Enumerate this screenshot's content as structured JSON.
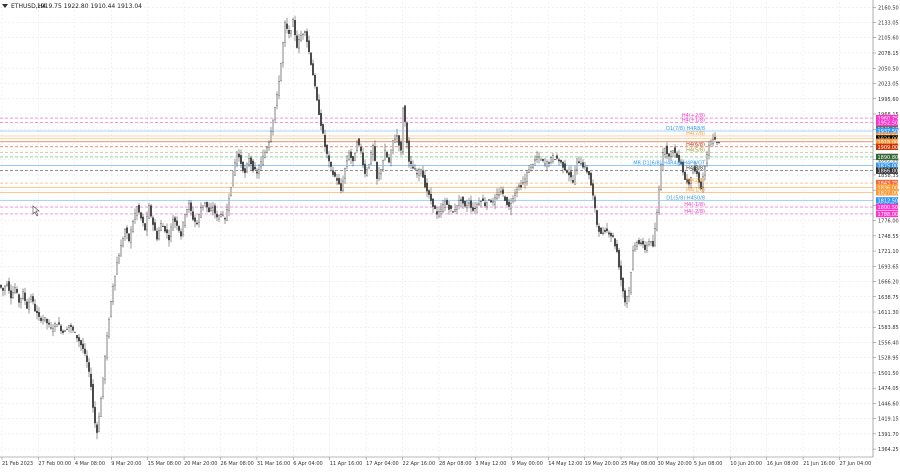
{
  "header": {
    "symbol": "ETHUSD,H4",
    "ohlc": "1919.75 1922.80 1910.44 1913.04"
  },
  "chart_data": {
    "type": "candlestick",
    "symbol": "ETHUSD",
    "timeframe": "H4",
    "grid": true,
    "ylim": [
      1350,
      2170
    ],
    "y_ticks": [
      "2160.50",
      "2133.05",
      "2105.60",
      "2078.15",
      "2050.50",
      "2023.05",
      "1995.60",
      "1968.15",
      "1940.70",
      "1913.25",
      "1885.80",
      "1858.35",
      "1830.90",
      "1803.45",
      "1776.00",
      "1748.55",
      "1721.10",
      "1693.65",
      "1666.20",
      "1638.75",
      "1611.30",
      "1583.85",
      "1556.40",
      "1528.95",
      "1501.50",
      "1474.05",
      "1446.60",
      "1419.15",
      "1391.70",
      "1364.25"
    ],
    "x_ticks": [
      "21 Feb 2023",
      "27 Feb 00:00",
      "4 Mar 08:00",
      "9 Mar 20:00",
      "15 Mar 08:00",
      "20 Mar 20:00",
      "26 Mar 08:00",
      "31 Mar 16:00",
      "6 Apr 04:00",
      "11 Apr 16:00",
      "17 Apr 04:00",
      "22 Apr 16:00",
      "28 Apr 08:00",
      "3 May 12:00",
      "9 May 00:00",
      "14 May 12:00",
      "19 May 20:00",
      "25 May 08:00",
      "30 May 20:00",
      "5 Jun 08:00",
      "10 Jun 20:00",
      "16 Jun 08:00",
      "21 Jun 16:00",
      "27 Jun 04:00"
    ],
    "price_path": [
      [
        0,
        1660
      ],
      [
        4,
        1650
      ],
      [
        8,
        1665
      ],
      [
        12,
        1640
      ],
      [
        16,
        1655
      ],
      [
        20,
        1630
      ],
      [
        24,
        1645
      ],
      [
        28,
        1620
      ],
      [
        32,
        1640
      ],
      [
        36,
        1615
      ],
      [
        40,
        1600
      ],
      [
        46,
        1598
      ],
      [
        52,
        1580
      ],
      [
        58,
        1592
      ],
      [
        64,
        1575
      ],
      [
        70,
        1588
      ],
      [
        76,
        1572
      ],
      [
        80,
        1560
      ],
      [
        84,
        1545
      ],
      [
        88,
        1520
      ],
      [
        92,
        1480
      ],
      [
        95,
        1420
      ],
      [
        98,
        1395
      ],
      [
        102,
        1455
      ],
      [
        106,
        1530
      ],
      [
        110,
        1600
      ],
      [
        114,
        1660
      ],
      [
        118,
        1700
      ],
      [
        122,
        1730
      ],
      [
        126,
        1760
      ],
      [
        130,
        1740
      ],
      [
        134,
        1775
      ],
      [
        138,
        1800
      ],
      [
        142,
        1780
      ],
      [
        146,
        1760
      ],
      [
        150,
        1800
      ],
      [
        154,
        1770
      ],
      [
        158,
        1745
      ],
      [
        162,
        1770
      ],
      [
        166,
        1760
      ],
      [
        170,
        1745
      ],
      [
        174,
        1780
      ],
      [
        178,
        1770
      ],
      [
        182,
        1750
      ],
      [
        186,
        1790
      ],
      [
        190,
        1805
      ],
      [
        194,
        1780
      ],
      [
        198,
        1770
      ],
      [
        202,
        1800
      ],
      [
        206,
        1810
      ],
      [
        210,
        1790
      ],
      [
        214,
        1800
      ],
      [
        218,
        1780
      ],
      [
        222,
        1790
      ],
      [
        226,
        1775
      ],
      [
        230,
        1820
      ],
      [
        234,
        1860
      ],
      [
        238,
        1900
      ],
      [
        242,
        1880
      ],
      [
        246,
        1860
      ],
      [
        250,
        1890
      ],
      [
        254,
        1870
      ],
      [
        258,
        1860
      ],
      [
        262,
        1880
      ],
      [
        266,
        1900
      ],
      [
        270,
        1920
      ],
      [
        274,
        1960
      ],
      [
        278,
        2000
      ],
      [
        282,
        2060
      ],
      [
        286,
        2130
      ],
      [
        290,
        2110
      ],
      [
        294,
        2135
      ],
      [
        298,
        2090
      ],
      [
        302,
        2110
      ],
      [
        306,
        2120
      ],
      [
        310,
        2080
      ],
      [
        314,
        2040
      ],
      [
        318,
        1990
      ],
      [
        322,
        1950
      ],
      [
        326,
        1910
      ],
      [
        330,
        1880
      ],
      [
        334,
        1860
      ],
      [
        338,
        1850
      ],
      [
        342,
        1830
      ],
      [
        346,
        1870
      ],
      [
        350,
        1900
      ],
      [
        354,
        1880
      ],
      [
        358,
        1920
      ],
      [
        362,
        1900
      ],
      [
        366,
        1860
      ],
      [
        370,
        1880
      ],
      [
        374,
        1910
      ],
      [
        378,
        1850
      ],
      [
        382,
        1870
      ],
      [
        386,
        1900
      ],
      [
        390,
        1880
      ],
      [
        394,
        1920
      ],
      [
        398,
        1930
      ],
      [
        402,
        1900
      ],
      [
        404,
        1980
      ],
      [
        407,
        1940
      ],
      [
        410,
        1880
      ],
      [
        414,
        1870
      ],
      [
        418,
        1860
      ],
      [
        422,
        1870
      ],
      [
        426,
        1840
      ],
      [
        430,
        1820
      ],
      [
        434,
        1805
      ],
      [
        438,
        1785
      ],
      [
        442,
        1795
      ],
      [
        446,
        1810
      ],
      [
        450,
        1800
      ],
      [
        454,
        1790
      ],
      [
        458,
        1805
      ],
      [
        462,
        1815
      ],
      [
        466,
        1800
      ],
      [
        470,
        1810
      ],
      [
        474,
        1795
      ],
      [
        478,
        1805
      ],
      [
        482,
        1815
      ],
      [
        486,
        1805
      ],
      [
        490,
        1815
      ],
      [
        494,
        1808
      ],
      [
        498,
        1820
      ],
      [
        502,
        1830
      ],
      [
        506,
        1815
      ],
      [
        510,
        1800
      ],
      [
        514,
        1820
      ],
      [
        518,
        1835
      ],
      [
        522,
        1840
      ],
      [
        526,
        1850
      ],
      [
        530,
        1870
      ],
      [
        534,
        1880
      ],
      [
        538,
        1890
      ],
      [
        542,
        1885
      ],
      [
        546,
        1878
      ],
      [
        550,
        1882
      ],
      [
        554,
        1890
      ],
      [
        558,
        1888
      ],
      [
        562,
        1880
      ],
      [
        566,
        1870
      ],
      [
        570,
        1860
      ],
      [
        574,
        1845
      ],
      [
        578,
        1885
      ],
      [
        582,
        1880
      ],
      [
        586,
        1870
      ],
      [
        590,
        1860
      ],
      [
        594,
        1820
      ],
      [
        598,
        1770
      ],
      [
        602,
        1750
      ],
      [
        606,
        1760
      ],
      [
        610,
        1755
      ],
      [
        614,
        1745
      ],
      [
        618,
        1720
      ],
      [
        622,
        1670
      ],
      [
        626,
        1630
      ],
      [
        630,
        1650
      ],
      [
        634,
        1720
      ],
      [
        638,
        1740
      ],
      [
        642,
        1735
      ],
      [
        646,
        1725
      ],
      [
        650,
        1740
      ],
      [
        654,
        1730
      ],
      [
        658,
        1790
      ],
      [
        662,
        1880
      ],
      [
        666,
        1910
      ],
      [
        670,
        1890
      ],
      [
        674,
        1905
      ],
      [
        678,
        1890
      ],
      [
        682,
        1880
      ],
      [
        686,
        1850
      ],
      [
        690,
        1845
      ],
      [
        694,
        1870
      ],
      [
        698,
        1860
      ],
      [
        702,
        1835
      ],
      [
        706,
        1875
      ],
      [
        710,
        1910
      ],
      [
        714,
        1925
      ],
      [
        718,
        1915
      ]
    ],
    "levels": [
      {
        "label": "H4(+2/8)",
        "value": 1960.75,
        "color": "#ff33cc",
        "dash": true
      },
      {
        "label": "H4(+1/8)",
        "value": 1952.5,
        "color": "#ff33cc",
        "dash": true
      },
      {
        "label": "D1(7/8) H4R8/8",
        "value": 1937.5,
        "color": "#3399ff",
        "dash": false
      },
      {
        "label": "H4(7/8)",
        "value": 1928.5,
        "color": "#ff9933",
        "dash": false
      },
      {
        "label": "",
        "value": 1924.0,
        "color": "#ff9933",
        "dash": false
      },
      {
        "label": "",
        "value": 1918.0,
        "color": "#cc3300",
        "dash": false
      },
      {
        "label": "H4(6/8)",
        "value": 1909.0,
        "color": "#cc3300",
        "dash": true
      },
      {
        "label": "H4(5/8)",
        "value": 1899.0,
        "color": "#999933",
        "dash": true
      },
      {
        "label": "",
        "value": 1890.8,
        "color": "#33aa55",
        "dash": true
      },
      {
        "label": "MR D1[6/8] H4R4/8 H4PIVOT",
        "value": 1875.0,
        "color": "#3399ff",
        "dash": false
      },
      {
        "label": "H4(3/8)",
        "value": 1866.0,
        "color": "#333333",
        "dash": true
      },
      {
        "label": "H4(2/8)",
        "value": 1843.75,
        "color": "#ff9933",
        "dash": true
      },
      {
        "label": "",
        "value": 1836.0,
        "color": "#ff9933",
        "dash": false
      },
      {
        "label": "H4(1/8)",
        "value": 1827.0,
        "color": "#ff9933",
        "dash": false
      },
      {
        "label": "D1(5/8) H4S0/8",
        "value": 1812.5,
        "color": "#3399ff",
        "dash": false
      },
      {
        "label": "H4(-1/8)",
        "value": 1800.5,
        "color": "#ff33cc",
        "dash": true
      },
      {
        "label": "H4(-2/8)",
        "value": 1788.0,
        "color": "#ff33cc",
        "dash": true
      }
    ],
    "price_tags": [
      {
        "text": "1960.75",
        "value": 1960.75,
        "bg": "#ff33cc"
      },
      {
        "text": "1952.50",
        "value": 1952.5,
        "bg": "#ff33cc"
      },
      {
        "text": "1941.06",
        "value": 1941.06,
        "bg": "#666666"
      },
      {
        "text": "1937.50",
        "value": 1937.5,
        "bg": "#3399ff"
      },
      {
        "text": "1928.50",
        "value": 1928.5,
        "bg": "#ff9933"
      },
      {
        "text": "1924.00",
        "value": 1924.0,
        "bg": "#000000"
      },
      {
        "text": "1918.00",
        "value": 1918.0,
        "bg": "#ff9933"
      },
      {
        "text": "1909.00",
        "value": 1909.0,
        "bg": "#cc3300"
      },
      {
        "text": "1890.80",
        "value": 1890.8,
        "bg": "#336633"
      },
      {
        "text": "1875.00",
        "value": 1875.0,
        "bg": "#3399ff"
      },
      {
        "text": "1866.00",
        "value": 1866.0,
        "bg": "#333333"
      },
      {
        "text": "1843.75",
        "value": 1843.75,
        "bg": "#ff6633"
      },
      {
        "text": "1836.00",
        "value": 1836.0,
        "bg": "#ff9933"
      },
      {
        "text": "1827.00",
        "value": 1827.0,
        "bg": "#ff9933"
      },
      {
        "text": "1812.50",
        "value": 1812.5,
        "bg": "#3399ff"
      },
      {
        "text": "1800.50",
        "value": 1800.5,
        "bg": "#ff33cc"
      },
      {
        "text": "1788.00",
        "value": 1788.0,
        "bg": "#ff33cc"
      }
    ]
  }
}
